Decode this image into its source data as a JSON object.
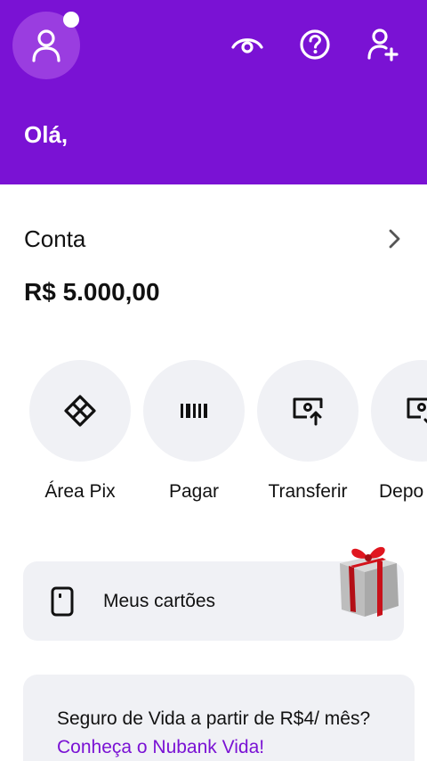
{
  "header": {
    "greeting": "Olá,",
    "icons": [
      "profile-icon",
      "eye-icon",
      "help-icon",
      "add-user-icon"
    ],
    "colors": {
      "background": "#7a12d4"
    }
  },
  "account": {
    "title": "Conta",
    "balance": "R$ 5.000,00"
  },
  "actions": [
    {
      "label": "Área Pix",
      "icon": "pix-icon"
    },
    {
      "label": "Pagar",
      "icon": "barcode-icon"
    },
    {
      "label": "Transferir",
      "icon": "transfer-icon"
    },
    {
      "label": "Depo",
      "icon": "deposit-icon"
    }
  ],
  "cards": {
    "label": "Meus cartões",
    "icon": "card-icon"
  },
  "promo": {
    "text": "Seguro de Vida a partir de R$4/ mês? ",
    "link": "Conheça o Nubank Vida!"
  }
}
